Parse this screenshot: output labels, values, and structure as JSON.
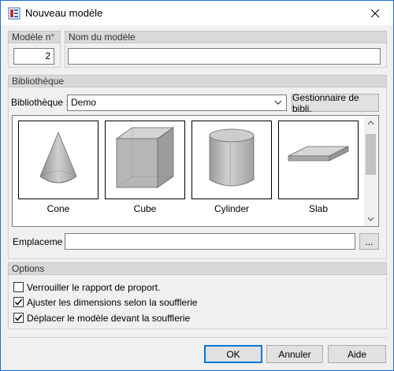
{
  "window": {
    "title": "Nouveau modèle",
    "icons": {
      "app": "model-icon",
      "close": "close-icon"
    }
  },
  "model_number": {
    "label": "Modèle n°",
    "value": "2"
  },
  "model_name": {
    "label": "Nom du modèle",
    "value": ""
  },
  "library": {
    "group_label": "Bibliothèque",
    "select_label": "Bibliothèque :",
    "selected": "Demo",
    "manager_button": "Gestionnaire de bibli.",
    "items": [
      {
        "name": "Cone",
        "icon": "cone-icon"
      },
      {
        "name": "Cube",
        "icon": "cube-icon"
      },
      {
        "name": "Cylinder",
        "icon": "cylinder-icon"
      },
      {
        "name": "Slab",
        "icon": "slab-icon"
      }
    ],
    "location_label": "Emplacement",
    "location_value": "",
    "browse_button": "..."
  },
  "options": {
    "group_label": "Options",
    "checkboxes": [
      {
        "label": "Verrouiller le rapport de proport.",
        "checked": false
      },
      {
        "label": "Ajuster les dimensions selon la soufflerie",
        "checked": true
      },
      {
        "label": "Déplacer le modèle devant la soufflerie",
        "checked": true
      }
    ]
  },
  "buttons": {
    "ok": "OK",
    "cancel": "Annuler",
    "help": "Aide"
  },
  "colors": {
    "accent": "#0078d7",
    "window_border": "#1f6fd0",
    "face": "#f0f0f0"
  }
}
